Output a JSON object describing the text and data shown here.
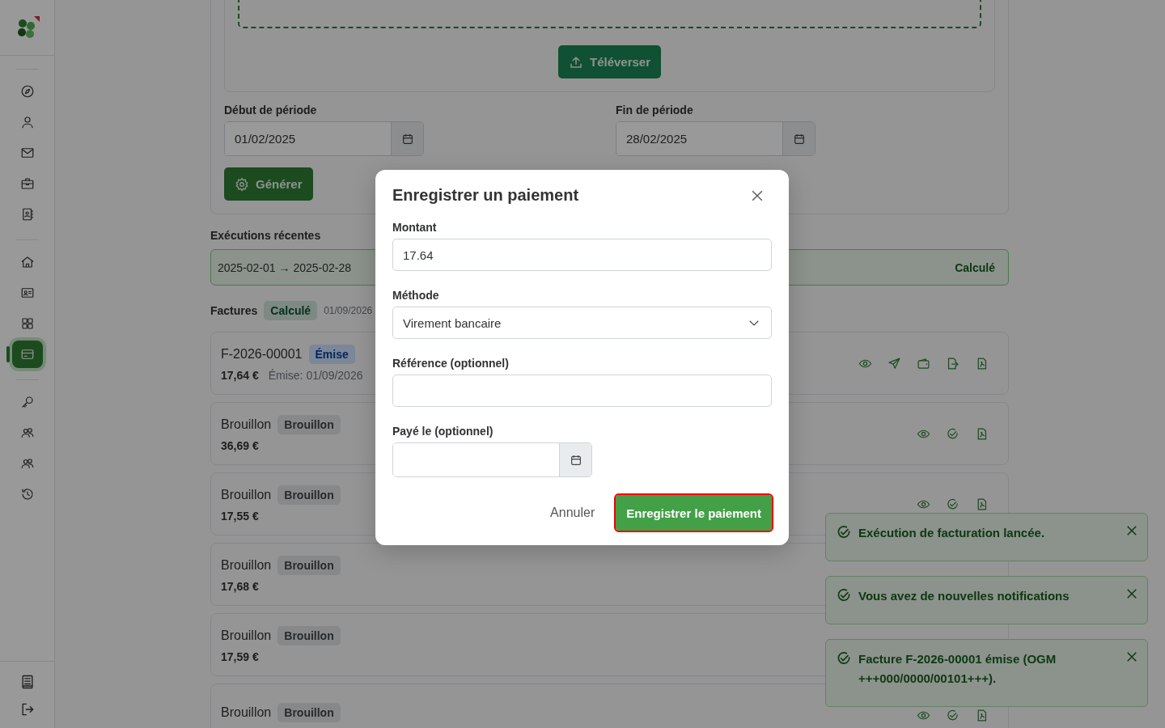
{
  "sidebar": {
    "groups": [
      {
        "items": [
          {
            "selected": false
          },
          {
            "selected": false
          },
          {
            "selected": false
          },
          {
            "selected": false
          },
          {
            "selected": false
          }
        ]
      },
      {
        "items": [
          {
            "selected": false
          },
          {
            "selected": false
          },
          {
            "selected": false
          },
          {
            "selected": true
          }
        ]
      },
      {
        "items": [
          {
            "selected": false
          },
          {
            "selected": false
          },
          {
            "selected": false
          },
          {
            "selected": false
          }
        ]
      }
    ],
    "footer_items": [
      {
        "selected": false
      },
      {
        "selected": false
      }
    ]
  },
  "upload": {
    "button": "Téléverser"
  },
  "period": {
    "start": {
      "label": "Début de période",
      "value": "01/02/2025"
    },
    "end": {
      "label": "Fin de période",
      "value": "28/02/2025"
    }
  },
  "generate_button": "Générer",
  "recent_runs": {
    "title": "Exécutions récentes",
    "runs": [
      {
        "range": "2025-02-01 → 2025-02-28",
        "status": "Calculé"
      }
    ]
  },
  "invoices": {
    "title": "Factures",
    "status": "Calculé",
    "date": "01/09/2026",
    "items": [
      {
        "kind": "issued",
        "number": "F-2026-00001",
        "badge": "Émise",
        "amount": "17,64 €",
        "issued": "Émise: 01/09/2026",
        "actions_visible": true
      },
      {
        "kind": "draft",
        "number": "Brouillon",
        "badge": "Brouillon",
        "amount": "36,69 €",
        "actions_visible": true
      },
      {
        "kind": "draft",
        "number": "Brouillon",
        "badge": "Brouillon",
        "amount": "17,55 €",
        "actions_visible": true
      },
      {
        "kind": "draft",
        "number": "Brouillon",
        "badge": "Brouillon",
        "amount": "17,68 €",
        "actions_visible": false
      },
      {
        "kind": "draft",
        "number": "Brouillon",
        "badge": "Brouillon",
        "amount": "17,59 €"
      },
      {
        "kind": "draft",
        "number": "Brouillon",
        "badge": "Brouillon",
        "actions_visible": true
      }
    ]
  },
  "modal": {
    "title": "Enregistrer un paiement",
    "fields": [
      {
        "kind": "text",
        "label": "Montant",
        "value": "17.64"
      },
      {
        "kind": "select",
        "label": "Méthode",
        "value": "Virement bancaire"
      },
      {
        "kind": "text",
        "label": "Référence (optionnel)"
      },
      {
        "kind": "date",
        "label": "Payé le (optionnel)"
      }
    ],
    "cancel": "Annuler",
    "submit": "Enregistrer le paiement"
  },
  "toasts": [
    {
      "message": "Exécution de facturation lancée."
    },
    {
      "message": "Vous avez de nouvelles notifications"
    },
    {
      "message": "Facture F-2026-00001 émise (OGM +++000/0000/00101+++)."
    }
  ]
}
